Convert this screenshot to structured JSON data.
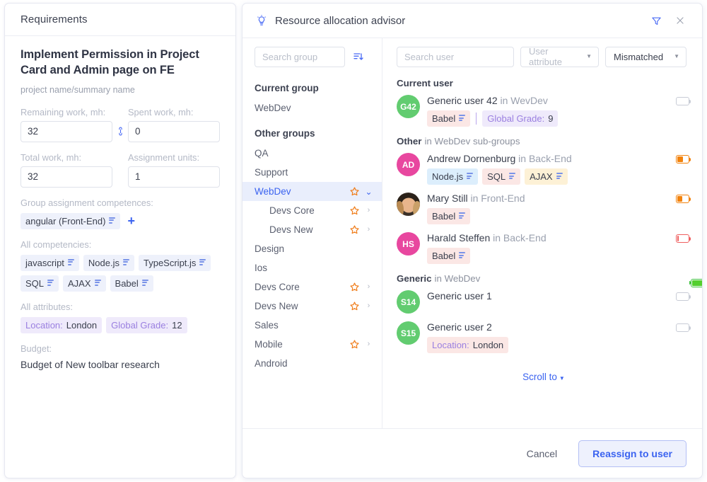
{
  "requirements": {
    "panel_title": "Requirements",
    "title": "Implement Permission in Project Card and Admin page on FE",
    "subtitle": "project name/summary name",
    "fields": {
      "remaining_label": "Remaining work, mh:",
      "remaining_value": "32",
      "spent_label": "Spent work, mh:",
      "spent_value": "0",
      "total_label": "Total work, mh:",
      "total_value": "32",
      "units_label": "Assignment units:",
      "units_value": "1",
      "link_icon": "link-icon"
    },
    "group_assignment_label": "Group assignment competences:",
    "group_assignment_chips": [
      {
        "label": "angular (Front-End)",
        "icon": "level-bars-icon"
      }
    ],
    "add_competence_label": "+",
    "all_competencies_label": "All competencies:",
    "all_competencies": [
      {
        "label": "javascript",
        "icon": "level-bars-icon"
      },
      {
        "label": "Node.js",
        "icon": "level-bars-icon"
      },
      {
        "label": "TypeScript.js",
        "icon": "level-bars-icon"
      },
      {
        "label": "SQL",
        "icon": "level-bars-icon"
      },
      {
        "label": "AJAX",
        "icon": "level-bars-icon"
      },
      {
        "label": "Babel",
        "icon": "level-bars-icon"
      }
    ],
    "all_attributes_label": "All attributes:",
    "all_attributes": [
      {
        "key": "Location:",
        "value": "London"
      },
      {
        "key": "Global Grade:",
        "value": "12"
      }
    ],
    "budget_label": "Budget:",
    "budget_value": "Budget of New toolbar research"
  },
  "dialog": {
    "title": "Resource allocation advisor",
    "bulb_icon": "lightbulb-icon",
    "filter_icon": "filter-icon",
    "close_icon": "close-icon",
    "group_search_placeholder": "Search group",
    "group_search_value": "",
    "sort_icon": "sort-descending-icon",
    "user_search_placeholder": "Search user",
    "user_search_value": "",
    "user_attribute_select": "User attribute",
    "match_select": "Mismatched",
    "scroll_to_label": "Scroll to",
    "cancel_label": "Cancel",
    "primary_label": "Reassign to user",
    "accent_color": "#3b63f0",
    "star_color": "#f07c19"
  },
  "groups": {
    "current_header": "Current group",
    "current": [
      {
        "name": "WebDev",
        "star": false,
        "chevron": "none",
        "selected": false,
        "child": false
      }
    ],
    "other_header": "Other groups",
    "other": [
      {
        "name": "QA",
        "star": false,
        "chevron": "none",
        "selected": false,
        "child": false
      },
      {
        "name": "Support",
        "star": false,
        "chevron": "none",
        "selected": false,
        "child": false
      },
      {
        "name": "WebDev",
        "star": true,
        "chevron": "down",
        "selected": true,
        "child": false
      },
      {
        "name": "Devs Core",
        "star": true,
        "chevron": "right",
        "selected": false,
        "child": true
      },
      {
        "name": "Devs New",
        "star": true,
        "chevron": "right",
        "selected": false,
        "child": true
      },
      {
        "name": "Design",
        "star": false,
        "chevron": "none",
        "selected": false,
        "child": false
      },
      {
        "name": "Ios",
        "star": false,
        "chevron": "none",
        "selected": false,
        "child": false
      },
      {
        "name": "Devs Core",
        "star": true,
        "chevron": "right",
        "selected": false,
        "child": false
      },
      {
        "name": "Devs New",
        "star": true,
        "chevron": "right",
        "selected": false,
        "child": false
      },
      {
        "name": "Sales",
        "star": false,
        "chevron": "none",
        "selected": false,
        "child": false
      },
      {
        "name": "Mobile",
        "star": true,
        "chevron": "right",
        "selected": false,
        "child": false
      },
      {
        "name": "Android",
        "star": false,
        "chevron": "none",
        "selected": false,
        "child": false
      }
    ]
  },
  "users": {
    "section_current": {
      "bold": "Current user",
      "normal": ""
    },
    "current": [
      {
        "initials": "G42",
        "avatar_color": "green",
        "avatar_type": "initials",
        "name": "Generic user 42",
        "in_group": "in WevDev",
        "battery": {
          "state": "empty",
          "percent": 0
        },
        "tags": [
          {
            "kind": "comp",
            "color": "pink",
            "label": "Babel",
            "icon": "level-bars-icon"
          },
          {
            "kind": "divider"
          },
          {
            "kind": "attr",
            "key": "Global Grade:",
            "value": "9"
          }
        ]
      }
    ],
    "section_other": {
      "bold": "Other",
      "normal": "in WebDev sub-groups"
    },
    "other": [
      {
        "initials": "AD",
        "avatar_color": "pink",
        "avatar_type": "initials",
        "name": "Andrew Dornenburg",
        "in_group": "in Back-End",
        "battery": {
          "state": "orange",
          "percent": 50
        },
        "tags": [
          {
            "kind": "comp",
            "color": "blue",
            "label": "Node.js",
            "icon": "level-bars-icon"
          },
          {
            "kind": "comp",
            "color": "pink",
            "label": "SQL",
            "icon": "level-bars-icon"
          },
          {
            "kind": "comp",
            "color": "cream",
            "label": "AJAX",
            "icon": "level-bars-icon"
          }
        ]
      },
      {
        "initials": "MS",
        "avatar_color": "photo",
        "avatar_type": "photo",
        "name": "Mary Still",
        "in_group": "in Front-End",
        "battery": {
          "state": "orange",
          "percent": 45
        },
        "tags": [
          {
            "kind": "comp",
            "color": "pink",
            "label": "Babel",
            "icon": "level-bars-icon"
          }
        ]
      },
      {
        "initials": "HS",
        "avatar_color": "pink",
        "avatar_type": "initials",
        "name": "Harald Steffen",
        "in_group": "in Back-End",
        "battery": {
          "state": "red",
          "percent": 10
        },
        "tags": [
          {
            "kind": "comp",
            "color": "pink",
            "label": "Babel",
            "icon": "level-bars-icon"
          }
        ]
      }
    ],
    "section_generic": {
      "bold": "Generic",
      "normal": "in WebDev",
      "battery": {
        "state": "green",
        "percent": 100
      }
    },
    "generic": [
      {
        "initials": "S14",
        "avatar_color": "green",
        "avatar_type": "initials",
        "name": "Generic user 1",
        "in_group": "",
        "battery": {
          "state": "empty",
          "percent": 0
        },
        "tags": []
      },
      {
        "initials": "S15",
        "avatar_color": "green",
        "avatar_type": "initials",
        "name": "Generic user 2",
        "in_group": "",
        "battery": {
          "state": "empty",
          "percent": 0
        },
        "tags": [
          {
            "kind": "attr2",
            "key": "Location:",
            "value": "London"
          }
        ]
      }
    ]
  }
}
